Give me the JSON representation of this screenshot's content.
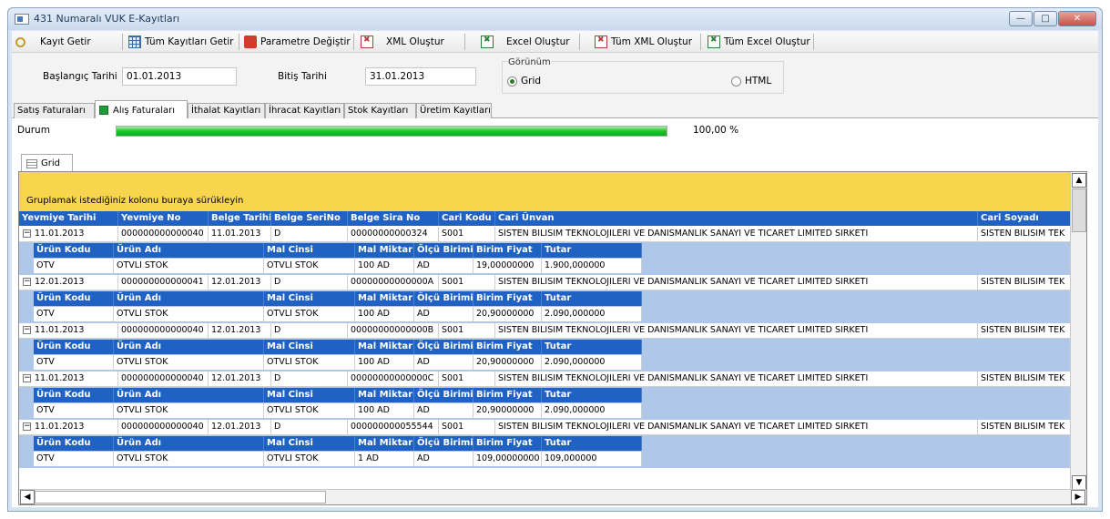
{
  "window": {
    "title": "431 Numaralı VUK E-Kayıtları"
  },
  "colors": {
    "grid_header": "#1f62c4",
    "group_panel": "#f7d54c",
    "detail_bg": "#afc8ea",
    "progress": "#23c12a"
  },
  "toolbar": {
    "kayit_getir": "Kayıt Getir",
    "tum_kayitlari_getir": "Tüm Kayıtları Getir",
    "parametre_degistir": "Parametre Değiştir",
    "xml_olustur": "XML Oluştur",
    "excel_olustur": "Excel Oluştur",
    "tum_xml_olustur": "Tüm XML Oluştur",
    "tum_excel_olustur": "Tüm Excel Oluştur"
  },
  "filter": {
    "baslangic_label": "Başlangıç Tarihi",
    "baslangic_value": "01.01.2013",
    "bitis_label": "Bitiş Tarihi",
    "bitis_value": "31.01.2013",
    "gorunum_label": "Görünüm",
    "grid_option": "Grid",
    "html_option": "HTML",
    "selected_view": "Grid"
  },
  "tabs": [
    "Satış Faturaları",
    "Alış Faturaları",
    "İthalat Kayıtları",
    "İhracat Kayıtları",
    "Stok Kayıtları",
    "Üretim Kayıtları"
  ],
  "active_tab": "Alış Faturaları",
  "status": {
    "label": "Durum",
    "percent_text": "100,00 %",
    "progress": 1.0
  },
  "grid": {
    "tab_label": "Grid",
    "group_hint": "Gruplamak istediğiniz kolonu buraya sürükleyin",
    "columns": [
      "Yevmiye Tarihi",
      "Yevmiye No",
      "Belge Tarihi",
      "Belge SeriNo",
      "Belge Sira No",
      "Cari Kodu",
      "Cari Ünvan",
      "Cari Soyadı"
    ],
    "detail_columns": [
      "Ürün Kodu",
      "Ürün Adı",
      "Mal Cinsi",
      "Mal Miktar",
      "Ölçü Birimi",
      "Birim Fiyat",
      "Tutar"
    ],
    "rows": [
      {
        "cells": [
          "11.01.2013",
          "000000000000040",
          "11.01.2013",
          "D",
          "00000000000324",
          "S001",
          "SISTEN BILISIM TEKNOLOJILERI VE DANISMANLIK SANAYI VE TICARET LIMITED SIRKETI",
          "SISTEN BILISIM TEK"
        ],
        "detail": [
          "OTV",
          "OTVLI STOK",
          "OTVLI STOK",
          "100 AD",
          "AD",
          "19,00000000",
          "1.900,000000"
        ]
      },
      {
        "cells": [
          "12.01.2013",
          "000000000000041",
          "12.01.2013",
          "D",
          "00000000000000A",
          "S001",
          "SISTEN BILISIM TEKNOLOJILERI VE DANISMANLIK SANAYI VE TICARET LIMITED SIRKETI",
          "SISTEN BILISIM TEK"
        ],
        "detail": [
          "OTV",
          "OTVLI STOK",
          "OTVLI STOK",
          "100 AD",
          "AD",
          "20,90000000",
          "2.090,000000"
        ]
      },
      {
        "cells": [
          "11.01.2013",
          "000000000000040",
          "12.01.2013",
          "D",
          "00000000000000B",
          "S001",
          "SISTEN BILISIM TEKNOLOJILERI VE DANISMANLIK SANAYI VE TICARET LIMITED SIRKETI",
          "SISTEN BILISIM TEK"
        ],
        "detail": [
          "OTV",
          "OTVLI STOK",
          "OTVLI STOK",
          "100 AD",
          "AD",
          "20,90000000",
          "2.090,000000"
        ]
      },
      {
        "cells": [
          "11.01.2013",
          "000000000000040",
          "12.01.2013",
          "D",
          "00000000000000C",
          "S001",
          "SISTEN BILISIM TEKNOLOJILERI VE DANISMANLIK SANAYI VE TICARET LIMITED SIRKETI",
          "SISTEN BILISIM TEK"
        ],
        "detail": [
          "OTV",
          "OTVLI STOK",
          "OTVLI STOK",
          "100 AD",
          "AD",
          "20,90000000",
          "2.090,000000"
        ]
      },
      {
        "cells": [
          "11.01.2013",
          "000000000000040",
          "12.01.2013",
          "D",
          "000000000055544",
          "S001",
          "SISTEN BILISIM TEKNOLOJILERI VE DANISMANLIK SANAYI VE TICARET LIMITED SIRKETI",
          "SISTEN BILISIM TEK"
        ],
        "detail": [
          "OTV",
          "OTVLI STOK",
          "OTVLI STOK",
          "1 AD",
          "AD",
          "109,00000000",
          "109,000000"
        ]
      }
    ]
  }
}
